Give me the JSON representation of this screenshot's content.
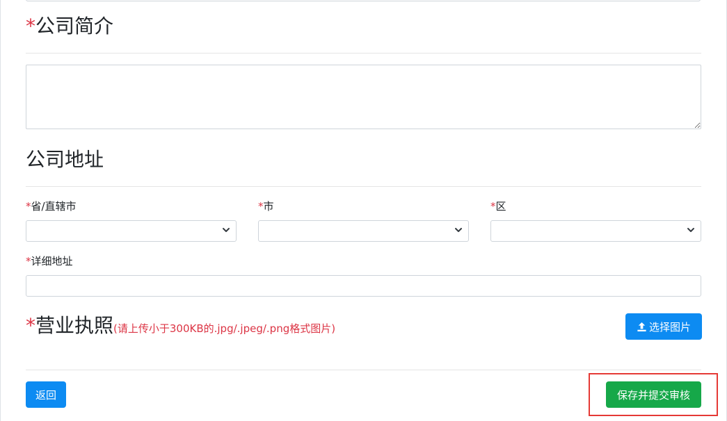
{
  "company_intro": {
    "required_mark": "*",
    "heading": "公司简介",
    "textarea_value": ""
  },
  "company_address": {
    "heading": "公司地址",
    "province": {
      "required_mark": "*",
      "label": "省/直辖市",
      "selected": ""
    },
    "city": {
      "required_mark": "*",
      "label": "市",
      "selected": ""
    },
    "district": {
      "required_mark": "*",
      "label": "区",
      "selected": ""
    },
    "detail": {
      "required_mark": "*",
      "label": "详细地址",
      "value": ""
    }
  },
  "business_license": {
    "required_mark": "*",
    "heading": "营业执照",
    "hint": "(请上传小于300KB的.jpg/.jpeg/.png格式图片)",
    "upload_button": "选择图片",
    "upload_icon": "upload-icon"
  },
  "footer": {
    "back_button": "返回",
    "submit_button": "保存并提交审核"
  },
  "colors": {
    "required": "#dc3545",
    "primary": "#0d8bf2",
    "success": "#16a849",
    "highlight": "#e53935"
  }
}
